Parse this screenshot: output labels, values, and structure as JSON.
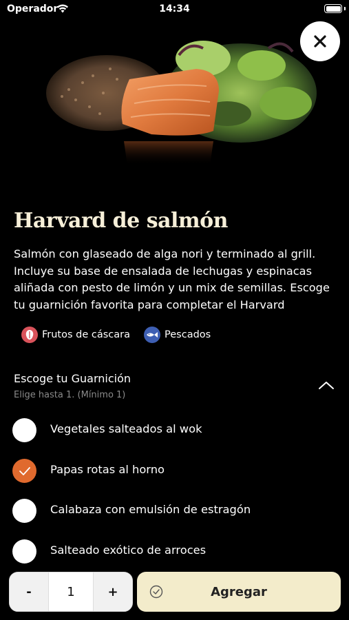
{
  "status_bar": {
    "carrier": "Operador",
    "time": "14:34"
  },
  "hero": {
    "image_icon": "salmon-salad-image"
  },
  "close": {
    "icon": "close-icon"
  },
  "dish": {
    "title": "Harvard de salmón",
    "description": "Salmón con glaseado de alga nori y terminado al grill. Incluye su base de ensalada de lechugas y espinacas aliñada con pesto de limón y un mix de semillas. Escoge tu guarnición favorita para completar el Harvard"
  },
  "allergens": [
    {
      "label": "Frutos de cáscara",
      "icon": "nut-icon",
      "color": "#d9535b"
    },
    {
      "label": "Pescados",
      "icon": "fish-icon",
      "color": "#3e5fb3"
    }
  ],
  "garnish": {
    "title": "Escoge tu Guarnición",
    "subtitle": "Elige hasta 1. (Mínimo 1)",
    "options": [
      {
        "label": "Vegetales salteados al wok",
        "checked": false
      },
      {
        "label": "Papas rotas al horno",
        "checked": true
      },
      {
        "label": "Calabaza con emulsión de estragón",
        "checked": false
      },
      {
        "label": "Salteado exótico de arroces",
        "checked": false
      }
    ]
  },
  "order": {
    "minus": "-",
    "quantity": "1",
    "plus": "+",
    "add_label": "Agregar"
  },
  "colors": {
    "accent": "#e06a2e",
    "title": "#f6efd8",
    "add_button": "#f3eccb"
  }
}
